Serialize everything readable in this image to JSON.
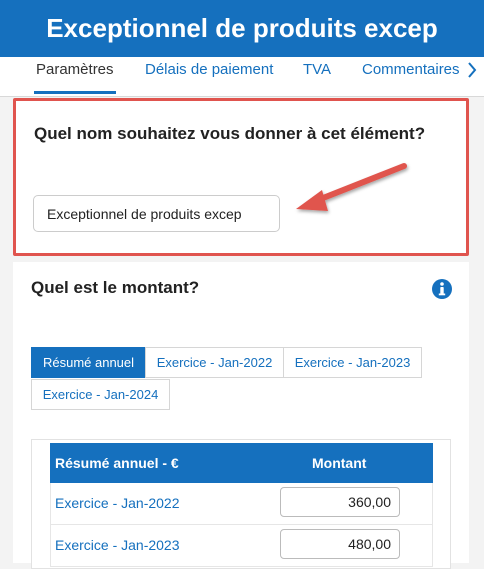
{
  "header": {
    "title": "Exceptionnel de produits excep"
  },
  "tabs": [
    {
      "label": "Paramètres"
    },
    {
      "label": "Délais de paiement"
    },
    {
      "label": "TVA"
    },
    {
      "label": "Commentaires"
    }
  ],
  "name_section": {
    "question": "Quel nom souhaitez vous donner à cet élément?",
    "value": "Exceptionnel de produits excep"
  },
  "amount_section": {
    "question": "Quel est le montant?",
    "year_tabs": [
      {
        "label": "Résumé annuel"
      },
      {
        "label": "Exercice - Jan-2022"
      },
      {
        "label": "Exercice - Jan-2023"
      },
      {
        "label": "Exercice - Jan-2024"
      }
    ],
    "table": {
      "headers": [
        "Résumé annuel - €",
        "Montant"
      ],
      "rows": [
        {
          "label": "Exercice - Jan-2022",
          "amount": "360,00"
        },
        {
          "label": "Exercice - Jan-2023",
          "amount": "480,00"
        }
      ]
    }
  },
  "colors": {
    "primary": "#1570be",
    "highlight": "#e0544e"
  },
  "icons": [
    "chevron-right-icon",
    "info-icon",
    "annotation-arrow-icon"
  ]
}
